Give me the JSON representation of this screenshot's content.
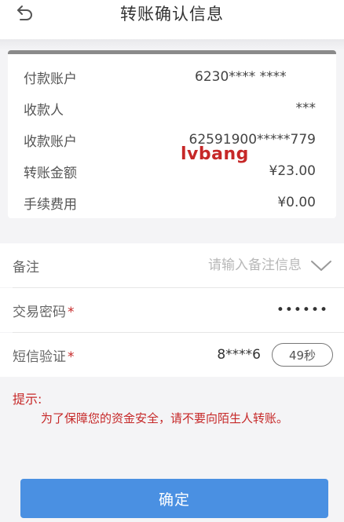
{
  "header": {
    "title": "转账确认信息",
    "back_icon": "back-arrow-icon"
  },
  "details": [
    {
      "label": "付款账户",
      "value": "6230**** ****"
    },
    {
      "label": "收款人",
      "value": "***"
    },
    {
      "label": "收款账户",
      "value": "62591900*****779"
    },
    {
      "label": "转账金额",
      "value": "¥23.00"
    },
    {
      "label": "手续费用",
      "value": "¥0.00"
    }
  ],
  "watermark": "lvbang",
  "form": {
    "remark": {
      "label": "备注",
      "placeholder": "请输入备注信息",
      "icon": "chevron-down-icon"
    },
    "password": {
      "label": "交易密码",
      "required_mark": "*",
      "value": "••••••"
    },
    "sms": {
      "label": "短信验证",
      "required_mark": "*",
      "value": "8****6",
      "countdown": "49秒"
    }
  },
  "tip": {
    "label": "提示:",
    "text": "为了保障您的资金安全，请不要向陌生人转账。"
  },
  "confirm_button": "确定",
  "colors": {
    "accent": "#4a90e2",
    "warning": "#c62828"
  }
}
